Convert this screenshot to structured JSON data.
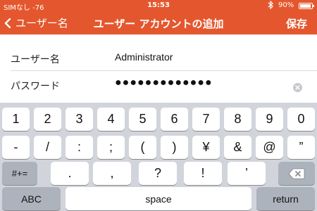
{
  "status_bar": {
    "carrier": "SIMなし -76",
    "time": "15:53",
    "battery": "90%"
  },
  "nav": {
    "back_label": "ユーザー名",
    "title": "ユーザー アカウントの追加",
    "save_label": "保存"
  },
  "form": {
    "username_label": "ユーザー名",
    "username_value": "Administrator",
    "password_label": "パスワード",
    "password_value": "●●●●●●●●●●●●●"
  },
  "keyboard": {
    "row1": [
      "1",
      "2",
      "3",
      "4",
      "5",
      "6",
      "7",
      "8",
      "9",
      "0"
    ],
    "row2": [
      "-",
      "/",
      ":",
      ";",
      "(",
      ")",
      "¥",
      "&",
      "@",
      "”"
    ],
    "row3_toggle": "#+=",
    "row3": [
      ".",
      ",",
      "?",
      "!",
      "’"
    ],
    "abc": "ABC",
    "space": "space",
    "return": "return"
  },
  "colors": {
    "accent": "#e4572e",
    "keyboard_bg": "#d1d5db",
    "key_dark": "#adb3bc"
  }
}
